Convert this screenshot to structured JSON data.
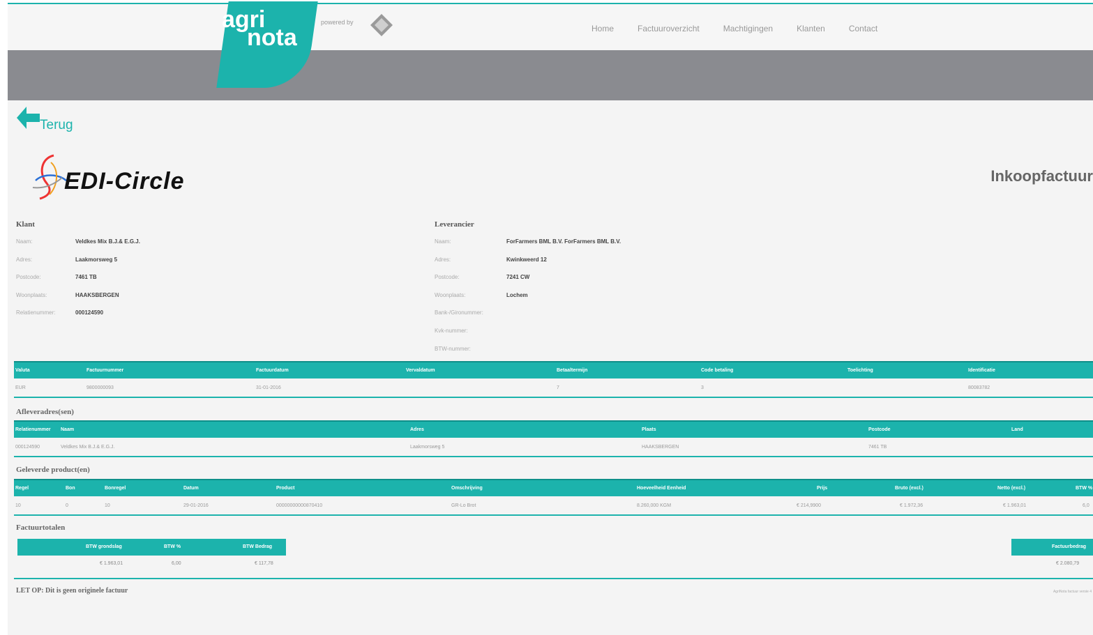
{
  "header": {
    "logo": {
      "line1": "agri",
      "line2": "nota"
    },
    "powered_by": "powered by",
    "nav": [
      "Home",
      "Factuuroverzicht",
      "Machtigingen",
      "Klanten",
      "Contact"
    ],
    "brand_color": "#1cb3ac"
  },
  "back_label": "Terug",
  "company_logo_text": "EDI-Circle",
  "doc_title": "Inkoopfactuur",
  "klant": {
    "title": "Klant",
    "rows": [
      {
        "label": "Naam:",
        "value": "Veldkes Mix B.J.& E.G.J."
      },
      {
        "label": "Adres:",
        "value": "Laakmorsweg 5"
      },
      {
        "label": "Postcode:",
        "value": "7461 TB"
      },
      {
        "label": "Woonplaats:",
        "value": "HAAKSBERGEN"
      },
      {
        "label": "Relatienummer:",
        "value": "000124590"
      }
    ]
  },
  "leverancier": {
    "title": "Leverancier",
    "rows": [
      {
        "label": "Naam:",
        "value": "ForFarmers BML B.V. ForFarmers BML B.V."
      },
      {
        "label": "Adres:",
        "value": "Kwinkweerd 12"
      },
      {
        "label": "Postcode:",
        "value": "7241 CW"
      },
      {
        "label": "Woonplaats:",
        "value": "Lochem"
      },
      {
        "label": "Bank-/Gironummer:",
        "value": ""
      },
      {
        "label": "Kvk-nummer:",
        "value": ""
      },
      {
        "label": "BTW-nummer:",
        "value": ""
      }
    ]
  },
  "invoice_table": {
    "headers": [
      "Valuta",
      "Factuurnummer",
      "Factuurdatum",
      "Vervaldatum",
      "Betaaltermijn",
      "Code betaling",
      "Toelichting",
      "Identificatie"
    ],
    "row": [
      "EUR",
      "9800000093",
      "31-01-2016",
      "",
      "7",
      "3",
      "",
      "80083782"
    ]
  },
  "afleveradres": {
    "title": "Afleveradres(sen)",
    "headers": [
      "Relatienummer",
      "Naam",
      "Adres",
      "Plaats",
      "Postcode",
      "Land"
    ],
    "row": [
      "000124590",
      "Veldkes Mix B.J.& E.G.J.",
      "Laakmorsweg 5",
      "HAAKSBERGEN",
      "7461 TB",
      ""
    ]
  },
  "producten": {
    "title": "Geleverde product(en)",
    "headers": [
      "Regel",
      "Bon",
      "Bonregel",
      "Datum",
      "Product",
      "Omschrijving",
      "Hoeveelheid Eenheid",
      "Prijs",
      "Bruto (excl.)",
      "Netto (excl.)",
      "BTW %"
    ],
    "row": [
      "10",
      "0",
      "10",
      "29-01-2016",
      "00000000000870410",
      "GR-Lo Brot",
      "8.260,000 KGM",
      "€ 214,9900",
      "€ 1.972,36",
      "€ 1.963,01",
      "6,0"
    ]
  },
  "totalen": {
    "title": "Factuurtotalen",
    "headers": [
      "BTW grondslag",
      "BTW %",
      "BTW Bedrag"
    ],
    "row": [
      "€ 1.963,01",
      "6,00",
      "€ 117,78"
    ],
    "right_header": "Factuurbedrag",
    "right_value": "€ 2.080,79"
  },
  "note": "LET OP: Dit is geen originele factuur",
  "footnote": "AgriNota factuur versie 4"
}
